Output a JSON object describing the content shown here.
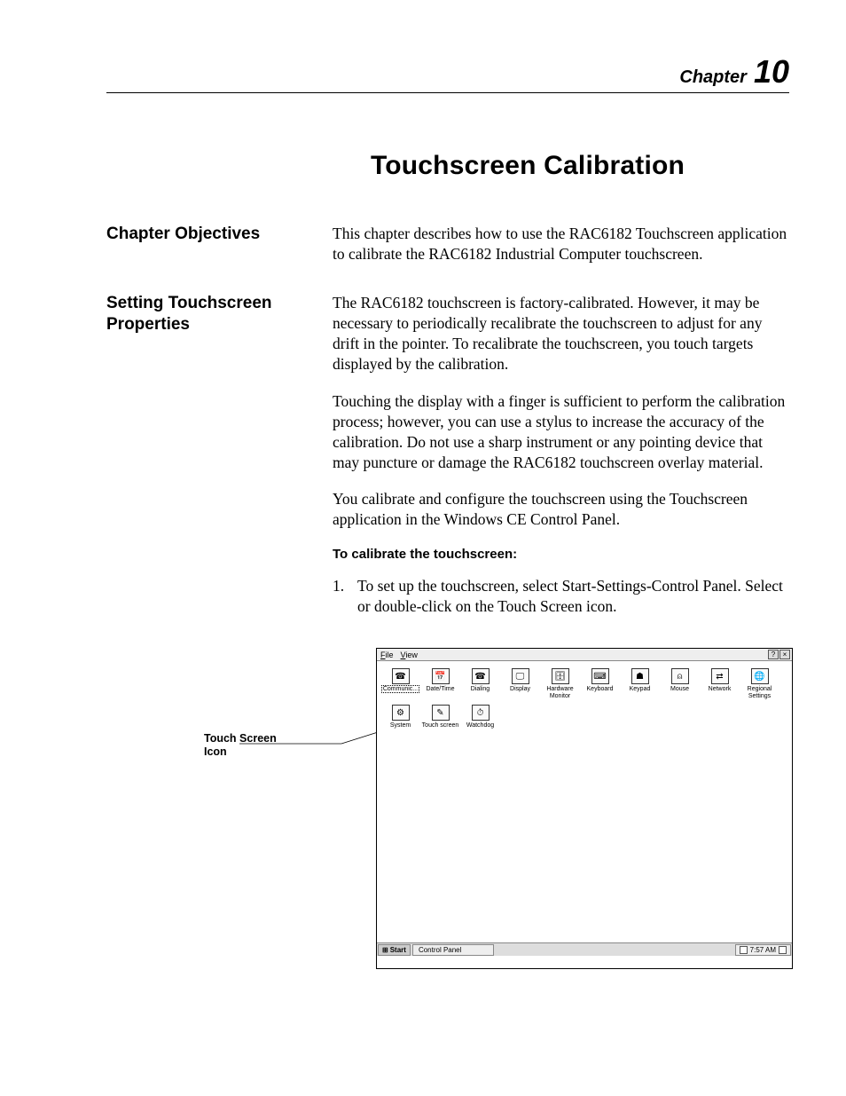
{
  "chapter": {
    "label": "Chapter",
    "number": "10"
  },
  "title": "Touchscreen Calibration",
  "sections": {
    "objectives": {
      "heading": "Chapter Objectives",
      "para1": "This chapter describes how to use the RAC6182 Touchscreen application to calibrate the RAC6182 Industrial Computer touchscreen."
    },
    "setting": {
      "heading": "Setting Touchscreen Properties",
      "para1": "The RAC6182 touchscreen is factory-calibrated.  However, it may be necessary to periodically recalibrate the touchscreen to adjust for any drift in the pointer.  To recalibrate the touchscreen, you touch targets displayed by the calibration.",
      "para2": "Touching the display with a finger is sufficient to perform the calibration process; however, you can use a stylus to increase the accuracy of the calibration.  Do not use a sharp instrument or any pointing device that may puncture or damage the RAC6182 touchscreen overlay material.",
      "para3": "You calibrate and configure the touchscreen using the Touchscreen application in the Windows CE Control Panel.",
      "subheading": "To calibrate the touchscreen:",
      "step1_num": "1.",
      "step1_text": "To set up the touchscreen, select Start-Settings-Control Panel.  Select or double-click on the Touch Screen icon."
    }
  },
  "callout": {
    "label": "Touch Screen Icon"
  },
  "control_panel": {
    "menu": {
      "file": "File",
      "file_u": "F",
      "view": "View",
      "view_u": "V"
    },
    "titlebtns": {
      "help": "?",
      "close": "×"
    },
    "icons": [
      {
        "label": "Communic...",
        "glyph": "☎",
        "selected": true
      },
      {
        "label": "Date/Time",
        "glyph": "📅"
      },
      {
        "label": "Dialing",
        "glyph": "☎"
      },
      {
        "label": "Display",
        "glyph": "🖵"
      },
      {
        "label": "Hardware Monitor",
        "glyph": "🗄"
      },
      {
        "label": "Keyboard",
        "glyph": "⌨"
      },
      {
        "label": "Keypad",
        "glyph": "☗"
      },
      {
        "label": "Mouse",
        "glyph": "⍝"
      },
      {
        "label": "Network",
        "glyph": "⇄"
      },
      {
        "label": "Regional Settings",
        "glyph": "🌐"
      },
      {
        "label": "System",
        "glyph": "⚙"
      },
      {
        "label": "Touch screen",
        "glyph": "✎"
      },
      {
        "label": "Watchdog",
        "glyph": "⏱"
      }
    ],
    "taskbar": {
      "start": "Start",
      "task": "Control Panel",
      "clock": "7:57 AM"
    }
  }
}
